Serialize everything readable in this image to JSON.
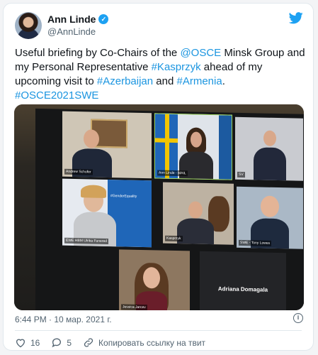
{
  "author": {
    "name": "Ann Linde",
    "handle": "@AnnLinde"
  },
  "tweet": {
    "p1": "Useful briefing by Co-Chairs of the ",
    "m_osce": "@OSCE",
    "p2": " Minsk Group and my Personal Representative ",
    "h_kasprzyk": "#Kasprzyk",
    "p3": " ahead of my upcoming visit to ",
    "h_azerbaijan": "#Azerbaijan",
    "p4": " and ",
    "h_armenia": "#Armenia",
    "p5": ".",
    "h_osce2021": "#OSCE2021SWE"
  },
  "photo": {
    "tiles": {
      "andrew": "Andrew Schofer",
      "ann": "Ann Linde - MAIL",
      "sv": "SV",
      "ewe": "EWE HBM Ulrika Funered",
      "gender": "#GenderEquality",
      "kasprzyk": "Kasprzyk",
      "tony": "SWE - Tony Lowes",
      "jessica": "Jessica Jarcev",
      "adriana": "Adriana Domagala"
    }
  },
  "meta": {
    "time": "6:44 PM · 10 мар. 2021 г."
  },
  "actions": {
    "likes": "16",
    "replies": "5",
    "copy_link": "Копировать ссылку на твит"
  },
  "colors": {
    "link": "#1b95e0",
    "twitter_blue": "#1da1f2",
    "muted": "#536471"
  }
}
